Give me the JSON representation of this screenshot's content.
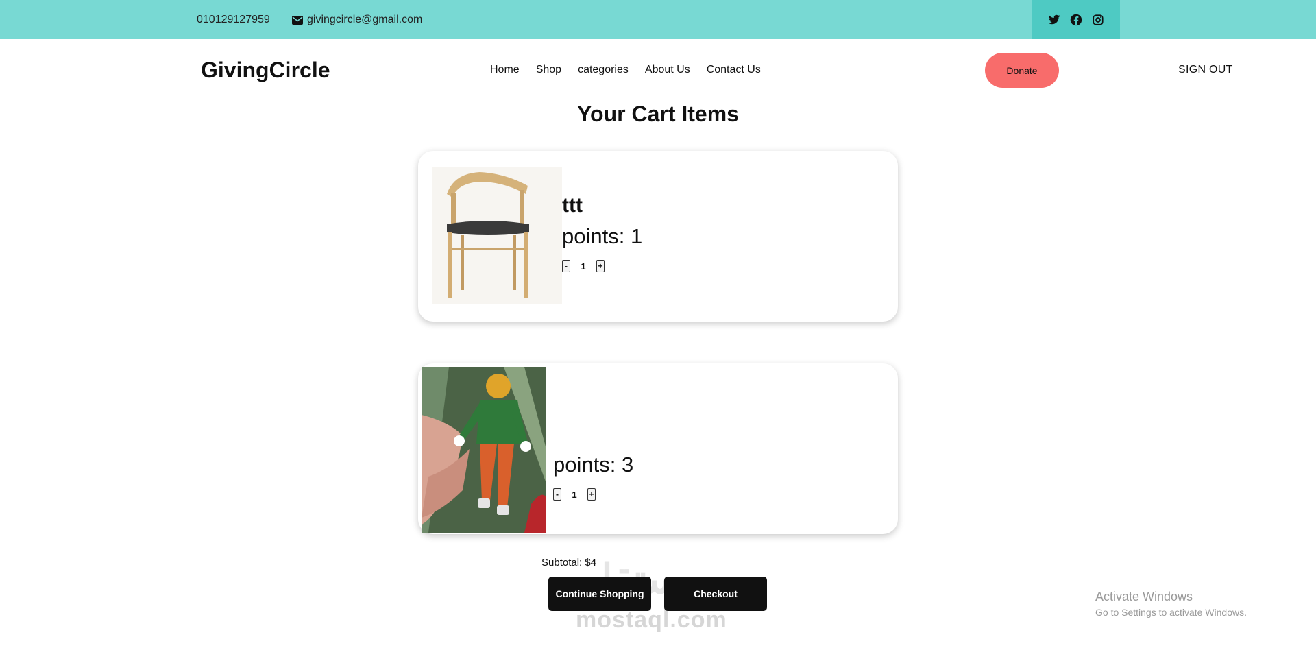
{
  "topbar": {
    "phone": "010129127959",
    "email": "givingcircle@gmail.com",
    "icons": [
      "envelope-icon",
      "twitter-icon",
      "facebook-icon",
      "instagram-icon"
    ],
    "colors": {
      "bar": "#78d9d3",
      "social_bg": "#4ecac3"
    }
  },
  "header": {
    "brand": "GivingCircle",
    "nav": [
      "Home",
      "Shop",
      "categories",
      "About Us",
      "Contact Us"
    ],
    "donate_label": "Donate",
    "signout_label": "SIGN OUT",
    "colors": {
      "donate": "#f86c6b"
    }
  },
  "main": {
    "title": "Your Cart Items",
    "items": [
      {
        "name": "ttt",
        "points": "points: 1",
        "qty": "1",
        "minus": "-",
        "plus": "+",
        "image": "wooden-chair"
      },
      {
        "name": "",
        "points": "points: 3",
        "qty": "1",
        "minus": "-",
        "plus": "+",
        "image": "toy-figure-in-hand"
      }
    ],
    "subtotal": "Subtotal: $4",
    "continue_label": "Continue Shopping",
    "checkout_label": "Checkout"
  },
  "overlay": {
    "watermark": "mostaql.com",
    "watermark_ar": "مستقل",
    "activate_title": "Activate Windows",
    "activate_sub": "Go to Settings to activate Windows."
  }
}
